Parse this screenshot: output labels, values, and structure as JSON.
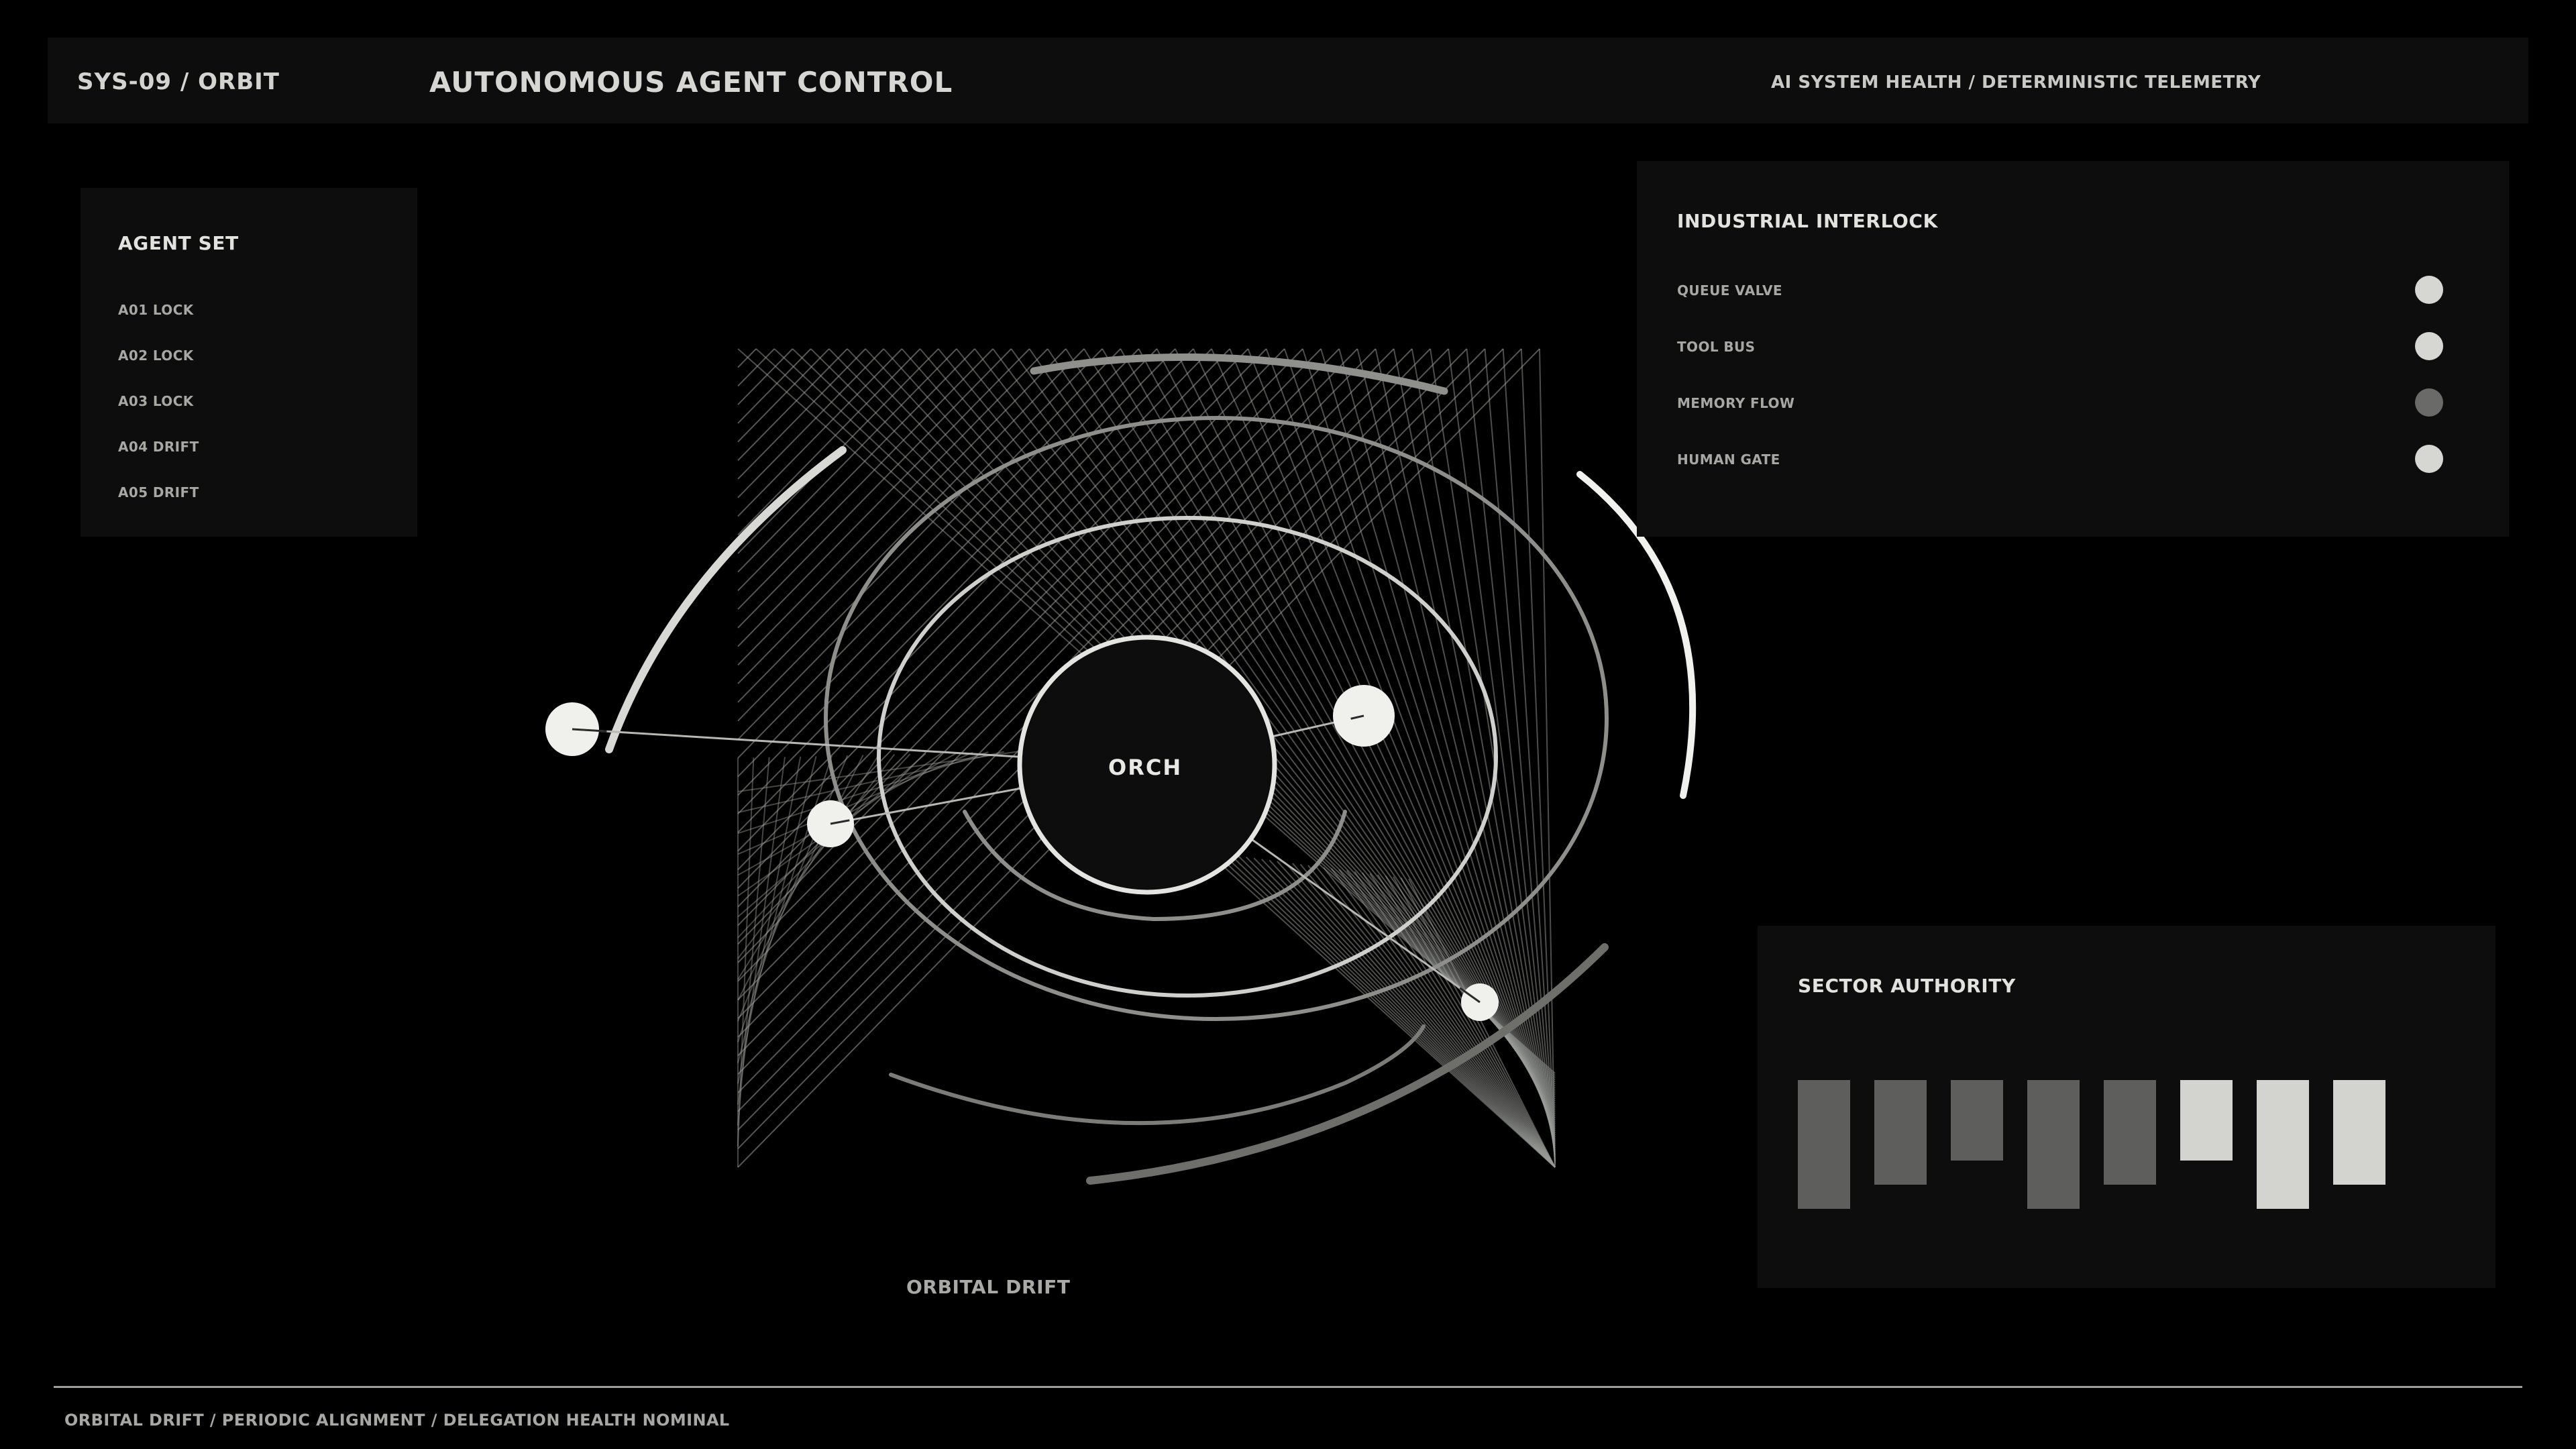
{
  "header": {
    "system": "SYS-09 / ORBIT",
    "title": "AUTONOMOUS AGENT CONTROL",
    "telemetry": "AI SYSTEM HEALTH / DETERMINISTIC TELEMETRY"
  },
  "agent_set": {
    "title": "AGENT SET",
    "items": [
      {
        "label": "A01 LOCK"
      },
      {
        "label": "A02 LOCK"
      },
      {
        "label": "A03 LOCK"
      },
      {
        "label": "A04 DRIFT"
      },
      {
        "label": "A05 DRIFT"
      }
    ]
  },
  "interlock": {
    "title": "INDUSTRIAL INTERLOCK",
    "rows": [
      {
        "label": "QUEUE VALVE",
        "color": "#d6d7d3"
      },
      {
        "label": "TOOL BUS",
        "color": "#d6d7d3"
      },
      {
        "label": "MEMORY FLOW",
        "color": "#6a6b68"
      },
      {
        "label": "HUMAN GATE",
        "color": "#d6d7d3"
      }
    ]
  },
  "sector": {
    "title": "SECTOR AUTHORITY",
    "bars": [
      {
        "offset": 0.0,
        "size": 0.8,
        "color": "#5e5f5c"
      },
      {
        "offset": 0.0,
        "size": 0.65,
        "color": "#5e5f5c"
      },
      {
        "offset": 0.0,
        "size": 0.5,
        "color": "#5e5f5c"
      },
      {
        "offset": 0.0,
        "size": 0.8,
        "color": "#5e5f5c"
      },
      {
        "offset": 0.0,
        "size": 0.65,
        "color": "#5e5f5c"
      },
      {
        "offset": 0.0,
        "size": 0.5,
        "color": "#d3d4d0"
      },
      {
        "offset": 0.0,
        "size": 0.8,
        "color": "#d3d4d0"
      },
      {
        "offset": 0.0,
        "size": 0.65,
        "color": "#d3d4d0"
      }
    ]
  },
  "orbit": {
    "core_label": "ORCH",
    "caption": "ORBITAL DRIFT"
  },
  "footer": {
    "status": "ORBITAL DRIFT / PERIODIC ALIGNMENT / DELEGATION HEALTH NOMINAL"
  },
  "colors": {
    "background": "#000000",
    "panel": "#0c0d0c",
    "bright": "#e6e7e3",
    "dim": "#5e5f5c"
  }
}
